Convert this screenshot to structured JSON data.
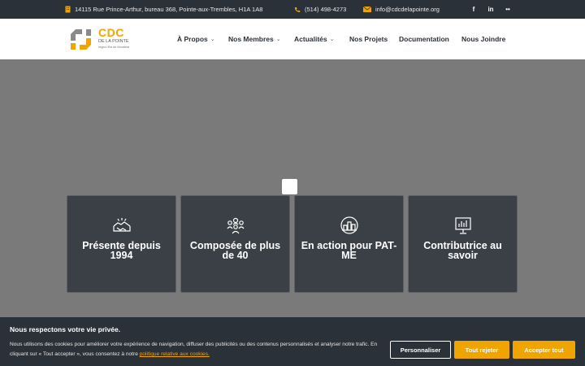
{
  "colors": {
    "accent": "#f0a400",
    "dark": "#2b3139",
    "card": "#3b4046"
  },
  "topbar": {
    "address": "14115 Rue Prince-Arthur, bureau 368, Pointe-aux-Trembles, H1A 1A8",
    "phone": "(514) 498-4273",
    "email": "info@cdcdelapointe.org",
    "address_icon": "building-icon",
    "phone_icon": "phone-icon",
    "email_icon": "envelope-icon",
    "social": {
      "facebook": "f",
      "linkedin": "in",
      "flickr": "••"
    }
  },
  "logo": {
    "name": "CDC",
    "sub": "DE LA POINTE",
    "tagline": "région Est de Montréal"
  },
  "nav": {
    "items": [
      "À Propos",
      "Nos Membres",
      "Actualités",
      "Nos Projets",
      "Documentation",
      "Nous Joindre"
    ]
  },
  "cards": [
    {
      "title": "Présente depuis 1994",
      "icon": "handshake-icon"
    },
    {
      "title": "Composée de plus de 40",
      "icon": "group-icon"
    },
    {
      "title": "En action pour PAT-ME",
      "icon": "city-icon"
    },
    {
      "title": "Contributrice au savoir",
      "icon": "presentation-icon"
    }
  ],
  "cookie": {
    "title": "Nous respectons votre vie privée.",
    "text": "Nous utilisons des cookies pour améliorer votre expérience de navigation, diffuser des publicités ou des contenus personnalisés et analyser notre trafic. En cliquant sur « Tout accepter », vous consentez à notre",
    "link": "politique relative aux cookies.",
    "customize": "Personnaliser",
    "reject": "Tout rejeter",
    "accept": "Accepter tout"
  }
}
